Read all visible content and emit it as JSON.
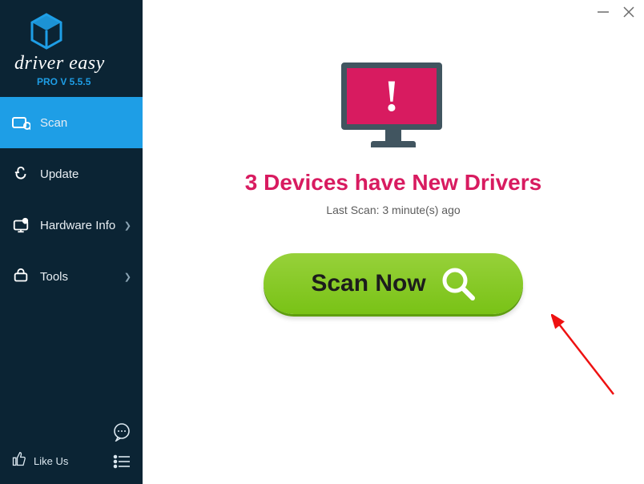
{
  "brand": {
    "name": "driver easy",
    "version": "PRO V 5.5.5"
  },
  "nav": {
    "scan": "Scan",
    "update": "Update",
    "hardware": "Hardware Info",
    "tools": "Tools"
  },
  "footer": {
    "like_us": "Like Us"
  },
  "main": {
    "headline": "3 Devices have New Drivers",
    "last_scan": "Last Scan: 3 minute(s) ago",
    "scan_button": "Scan Now"
  },
  "colors": {
    "sidebar_bg": "#0b2434",
    "accent": "#1e9ee6",
    "alert": "#d81b60",
    "action": "#87c924"
  }
}
